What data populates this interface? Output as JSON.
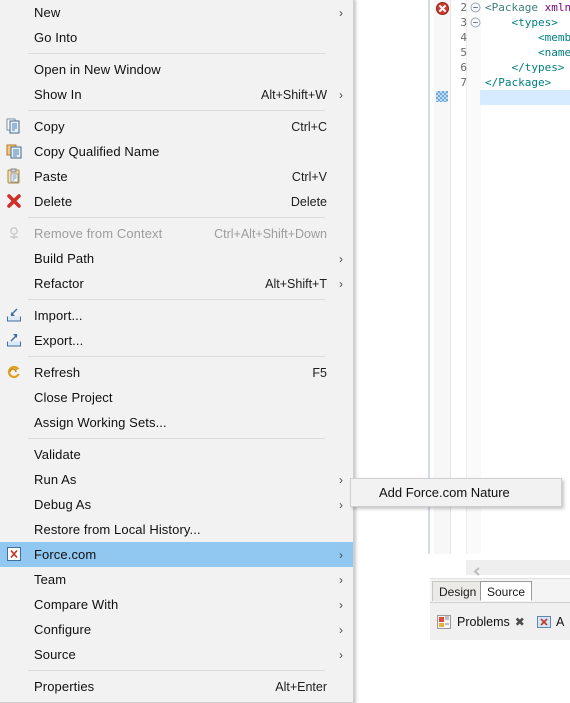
{
  "editor": {
    "code_lines": [
      {
        "num": "2",
        "fold": true,
        "segments": [
          {
            "t": "<Package ",
            "c": "tg"
          },
          {
            "t": "xmln",
            "c": "att"
          }
        ]
      },
      {
        "num": "3",
        "fold": true,
        "segments": [
          {
            "t": "    <types>",
            "c": "tgb"
          }
        ]
      },
      {
        "num": "4",
        "fold": false,
        "segments": [
          {
            "t": "        <memb",
            "c": "tgb"
          }
        ]
      },
      {
        "num": "5",
        "fold": false,
        "segments": [
          {
            "t": "        <name",
            "c": "tgb"
          }
        ]
      },
      {
        "num": "6",
        "fold": false,
        "segments": [
          {
            "t": "    </types>",
            "c": "tgb"
          }
        ]
      },
      {
        "num": "7",
        "fold": false,
        "segments": [
          {
            "t": "</Package>",
            "c": "tgb"
          }
        ]
      }
    ],
    "error_marker": "error-marker-icon",
    "overview_marker": "occurrence-marker",
    "editor_tabs": [
      {
        "label": "Design",
        "active": false
      },
      {
        "label": "Source",
        "active": true
      }
    ],
    "scroll_left_arrow": "scroll-left-arrow",
    "bottom_views": [
      {
        "label": "Problems",
        "icon": "problems-icon",
        "closable": true
      },
      {
        "label": "A",
        "icon": "apex-icon",
        "closable": false
      }
    ]
  },
  "context_menu": {
    "groups": [
      {
        "items": [
          {
            "label": "New",
            "accel": "",
            "arrow": true,
            "icon": null,
            "disabled": false,
            "selected": false
          },
          {
            "label": "Go Into",
            "accel": "",
            "arrow": false,
            "icon": null,
            "disabled": false,
            "selected": false
          }
        ]
      },
      {
        "items": [
          {
            "label": "Open in New Window",
            "accel": "",
            "arrow": false,
            "icon": null,
            "disabled": false,
            "selected": false
          },
          {
            "label": "Show In",
            "accel": "Alt+Shift+W",
            "arrow": true,
            "icon": null,
            "disabled": false,
            "selected": false
          }
        ]
      },
      {
        "items": [
          {
            "label": "Copy",
            "accel": "Ctrl+C",
            "arrow": false,
            "icon": "copy-icon",
            "disabled": false,
            "selected": false
          },
          {
            "label": "Copy Qualified Name",
            "accel": "",
            "arrow": false,
            "icon": "copy-qualified-name-icon",
            "disabled": false,
            "selected": false
          },
          {
            "label": "Paste",
            "accel": "Ctrl+V",
            "arrow": false,
            "icon": "paste-icon",
            "disabled": false,
            "selected": false
          },
          {
            "label": "Delete",
            "accel": "Delete",
            "arrow": false,
            "icon": "delete-icon",
            "disabled": false,
            "selected": false
          }
        ]
      },
      {
        "items": [
          {
            "label": "Remove from Context",
            "accel": "Ctrl+Alt+Shift+Down",
            "arrow": false,
            "icon": "remove-from-context-icon",
            "disabled": true,
            "selected": false
          },
          {
            "label": "Build Path",
            "accel": "",
            "arrow": true,
            "icon": null,
            "disabled": false,
            "selected": false
          },
          {
            "label": "Refactor",
            "accel": "Alt+Shift+T",
            "arrow": true,
            "icon": null,
            "disabled": false,
            "selected": false
          }
        ]
      },
      {
        "items": [
          {
            "label": "Import...",
            "accel": "",
            "arrow": false,
            "icon": "import-icon",
            "disabled": false,
            "selected": false
          },
          {
            "label": "Export...",
            "accel": "",
            "arrow": false,
            "icon": "export-icon",
            "disabled": false,
            "selected": false
          }
        ]
      },
      {
        "items": [
          {
            "label": "Refresh",
            "accel": "F5",
            "arrow": false,
            "icon": "refresh-icon",
            "disabled": false,
            "selected": false
          },
          {
            "label": "Close Project",
            "accel": "",
            "arrow": false,
            "icon": null,
            "disabled": false,
            "selected": false
          },
          {
            "label": "Assign Working Sets...",
            "accel": "",
            "arrow": false,
            "icon": null,
            "disabled": false,
            "selected": false
          }
        ]
      },
      {
        "items": [
          {
            "label": "Validate",
            "accel": "",
            "arrow": false,
            "icon": null,
            "disabled": false,
            "selected": false
          },
          {
            "label": "Run As",
            "accel": "",
            "arrow": true,
            "icon": null,
            "disabled": false,
            "selected": false
          },
          {
            "label": "Debug As",
            "accel": "",
            "arrow": true,
            "icon": null,
            "disabled": false,
            "selected": false
          },
          {
            "label": "Restore from Local History...",
            "accel": "",
            "arrow": false,
            "icon": null,
            "disabled": false,
            "selected": false
          },
          {
            "label": "Force.com",
            "accel": "",
            "arrow": true,
            "icon": "forcecom-icon",
            "disabled": false,
            "selected": true
          },
          {
            "label": "Team",
            "accel": "",
            "arrow": true,
            "icon": null,
            "disabled": false,
            "selected": false
          },
          {
            "label": "Compare With",
            "accel": "",
            "arrow": true,
            "icon": null,
            "disabled": false,
            "selected": false
          },
          {
            "label": "Configure",
            "accel": "",
            "arrow": true,
            "icon": null,
            "disabled": false,
            "selected": false
          },
          {
            "label": "Source",
            "accel": "",
            "arrow": true,
            "icon": null,
            "disabled": false,
            "selected": false
          }
        ]
      },
      {
        "items": [
          {
            "label": "Properties",
            "accel": "Alt+Enter",
            "arrow": false,
            "icon": null,
            "disabled": false,
            "selected": false
          }
        ]
      }
    ],
    "submenu": {
      "items": [
        {
          "label": "Add Force.com Nature"
        }
      ]
    }
  },
  "colors": {
    "menu_background": "#f2f2f2",
    "selection": "#91c8f2",
    "line_highlight": "#d6ebff",
    "tag": "#008080",
    "attribute": "#7f007f",
    "disabled_text": "#9d9d9d"
  }
}
